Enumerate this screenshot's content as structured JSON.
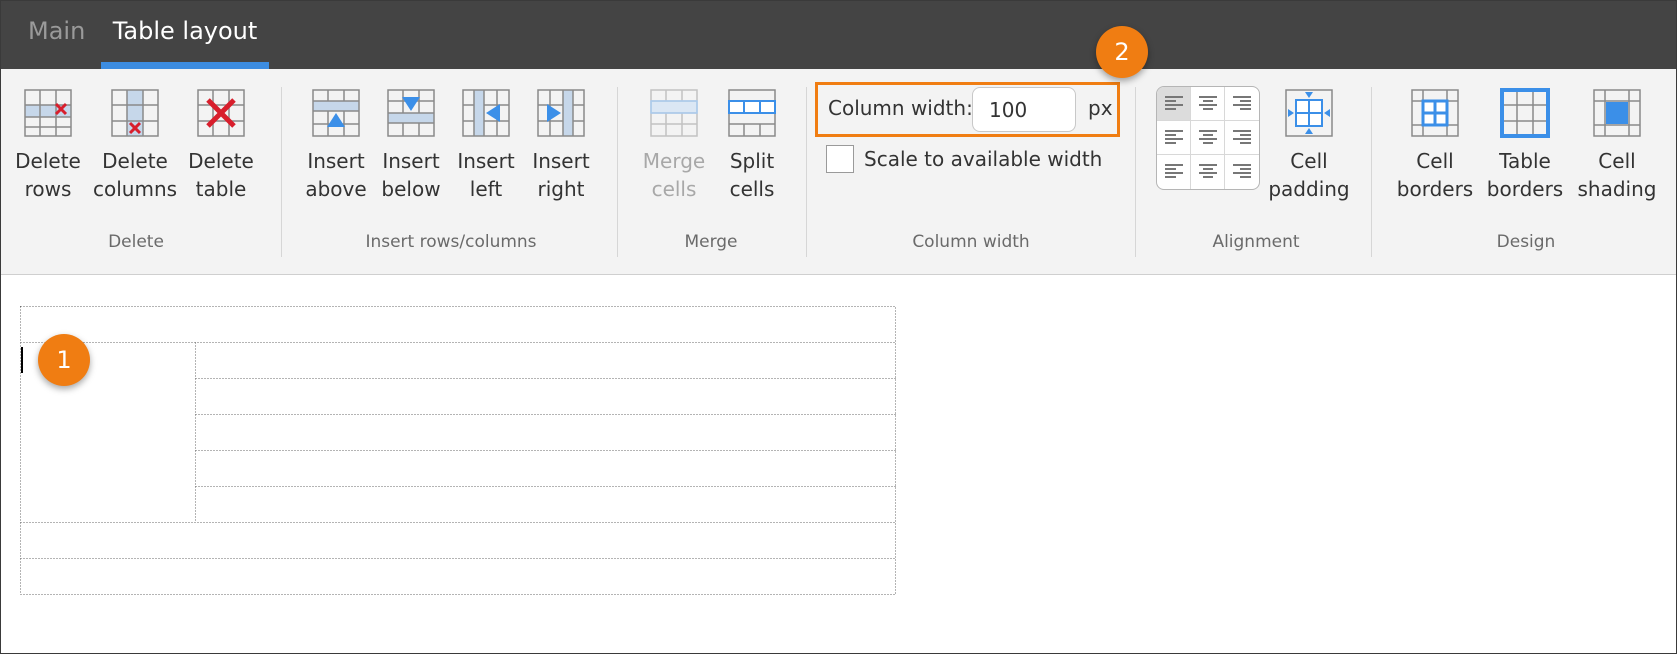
{
  "tabs": {
    "main": "Main",
    "table_layout": "Table layout"
  },
  "groups": {
    "delete": "Delete",
    "insert": "Insert rows/columns",
    "merge": "Merge",
    "column_width": "Column width",
    "alignment": "Alignment",
    "design": "Design"
  },
  "buttons": {
    "delete_rows": [
      "Delete",
      "rows"
    ],
    "delete_columns": [
      "Delete",
      "columns"
    ],
    "delete_table": [
      "Delete",
      "table"
    ],
    "insert_above": [
      "Insert",
      "above"
    ],
    "insert_below": [
      "Insert",
      "below"
    ],
    "insert_left": [
      "Insert",
      "left"
    ],
    "insert_right": [
      "Insert",
      "right"
    ],
    "merge_cells": [
      "Merge",
      "cells"
    ],
    "split_cells": [
      "Split",
      "cells"
    ],
    "cell_padding": [
      "Cell",
      "padding"
    ],
    "cell_borders": [
      "Cell",
      "borders"
    ],
    "table_borders": [
      "Table",
      "borders"
    ],
    "cell_shading": [
      "Cell",
      "shading"
    ]
  },
  "column_width": {
    "label": "Column width:",
    "value": "100",
    "unit": "px",
    "scale_label": "Scale to available width",
    "scale_checked": false
  },
  "alignment": {
    "selected": "top-left"
  },
  "callouts": {
    "one": "1",
    "two": "2"
  },
  "colors": {
    "accent_orange": "#f07d12",
    "tab_underline": "#3c8ce0",
    "icon_blue": "#3b8fe8",
    "delete_red": "#d81e2c"
  }
}
